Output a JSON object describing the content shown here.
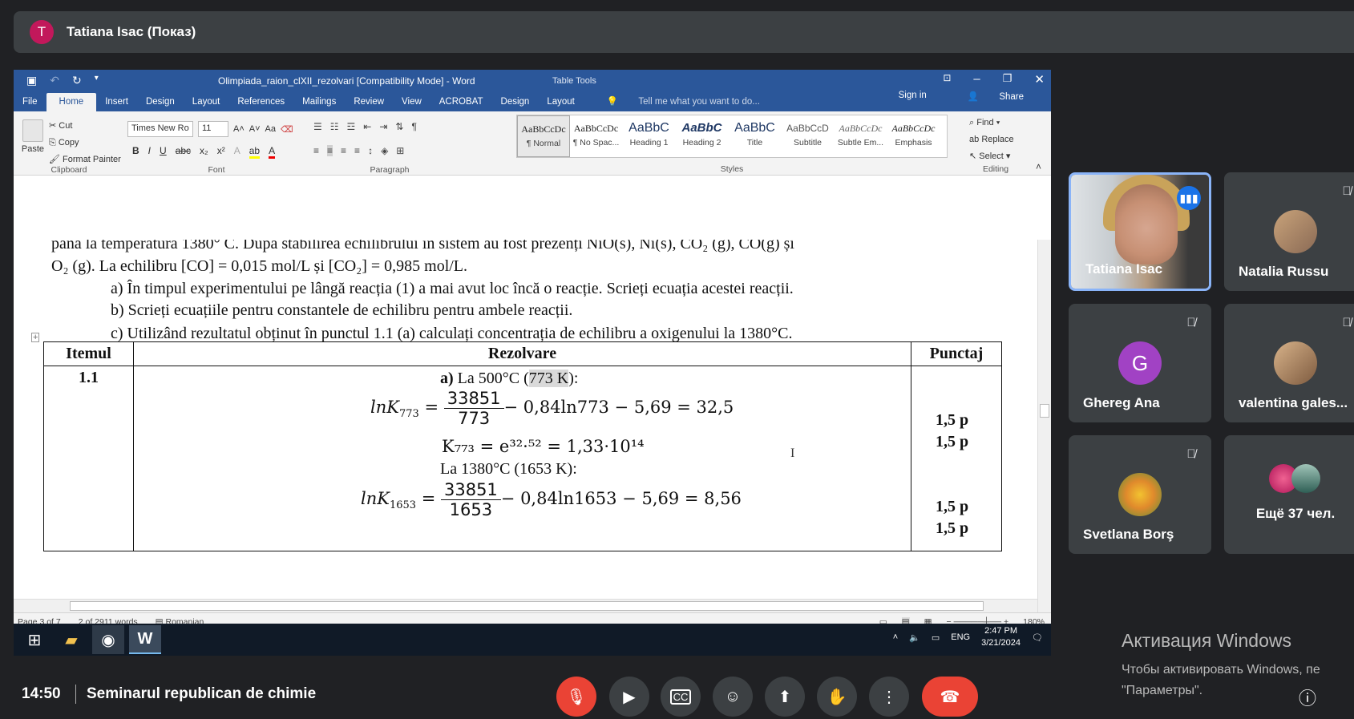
{
  "presenter": {
    "initial": "T",
    "label": "Tatiana Isac (Показ)"
  },
  "word": {
    "title": "Olimpiada_raion_clXII_rezolvari [Compatibility Mode] - Word",
    "contextual": "Table Tools",
    "tabs": [
      "File",
      "Home",
      "Insert",
      "Design",
      "Layout",
      "References",
      "Mailings",
      "Review",
      "View",
      "ACROBAT",
      "Design",
      "Layout"
    ],
    "tell_me": "Tell me what you want to do...",
    "sign_in": "Sign in",
    "share": "Share",
    "clipboard": {
      "paste": "Paste",
      "cut": "Cut",
      "copy": "Copy",
      "format_painter": "Format Painter",
      "label": "Clipboard"
    },
    "font": {
      "name": "Times New Ro",
      "size": "11",
      "label": "Font"
    },
    "paragraph_label": "Paragraph",
    "styles_label": "Styles",
    "styles": [
      {
        "preview": "AaBbCcDc",
        "name": "¶ Normal"
      },
      {
        "preview": "AaBbCcDc",
        "name": "¶ No Spac..."
      },
      {
        "preview": "AaBbC",
        "name": "Heading 1"
      },
      {
        "preview": "AaBbC",
        "name": "Heading 2"
      },
      {
        "preview": "AaBbC",
        "name": "Title"
      },
      {
        "preview": "AaBbCcD",
        "name": "Subtitle"
      },
      {
        "preview": "AaBbCcDc",
        "name": "Subtle Em..."
      },
      {
        "preview": "AaBbCcDc",
        "name": "Emphasis"
      }
    ],
    "editing": {
      "find": "Find",
      "replace": "Replace",
      "select": "Select",
      "label": "Editing"
    },
    "doc": {
      "line1": "până la temperatura 1380° C. După stabilirea echilibrului în sistem au fost prezenți NiO(s), Ni(s), CO₂ (g), CO(g) și",
      "line2": "O₂ (g).  La echilibru [CO] = 0,015 mol/L și [CO₂] =  0,985 mol/L.",
      "item_a": "a)   În timpul experimentului pe lângă reacția (1) a mai avut loc încă o reacție. Scrieți ecuația acestei reacții.",
      "item_b": "b)   Scrieți ecuațiile pentru constantele de echilibru pentru ambele reacții.",
      "item_c": "c)   Utilizând rezultatul obținut în punctul 1.1 (a) calculați concentrația de echilibru a oxigenului la 1380°C.",
      "th_item": "Itemul",
      "th_sol": "Rezolvare",
      "th_pts": "Punctaj",
      "row_id": "1.1",
      "a_label": "a)",
      "a_text": " La 500°C (",
      "a_kelvin": "773 K",
      "a_close": "):",
      "eq1_lhs": "lnK",
      "eq1_sub": "773",
      "eq1_num": "33851",
      "eq1_den": "773",
      "eq1_rest": "− 0,84ln773 − 5,69 = 32,5",
      "eq2": "K₇₇₃ = e³²·⁵² = 1,33·10¹⁴",
      "b_text": "La 1380°C (1653 K):",
      "eq3_lhs": "lnK",
      "eq3_sub": "1653",
      "eq3_num": "33851",
      "eq3_den": "1653",
      "eq3_rest": "− 0,84ln1653 − 5,69 = 8,56",
      "points": [
        "1,5 p",
        "1,5 p",
        "1,5 p",
        "1,5 p"
      ]
    },
    "status": {
      "page": "Page 3 of 7",
      "words": "2 of 2911 words",
      "lang": "Romanian",
      "zoom": "180%"
    }
  },
  "taskbar": {
    "lang": "ENG",
    "time": "2:47 PM",
    "date": "3/21/2024"
  },
  "tiles": [
    {
      "name": "Tatiana Isac"
    },
    {
      "name": "Natalia Russu"
    },
    {
      "name": "Ghereg Ana",
      "initial": "G"
    },
    {
      "name": "valentina gales..."
    },
    {
      "name": "Svetlana Borş"
    },
    {
      "name": "Ещё 37 чел."
    }
  ],
  "activation": {
    "title": "Активация Windows",
    "line1": "Чтобы активировать Windows, пе",
    "line2": "\"Параметры\"."
  },
  "meeting": {
    "time": "14:50",
    "title": "Seminarul republican de chimie"
  }
}
